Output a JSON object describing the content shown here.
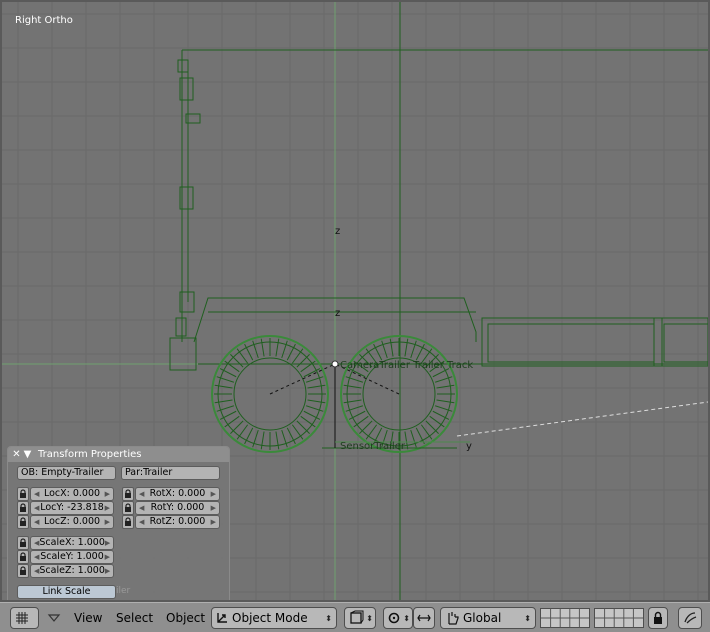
{
  "viewport": {
    "label": "Right Ortho",
    "axis_labels": {
      "z1": "z",
      "z2": "z",
      "y": "y"
    },
    "object_labels": {
      "trailer_track": "CameraTrailer  Trailer Track",
      "sensor": "SensorTrailer"
    },
    "colors": {
      "background": "#737373",
      "grid": "#6a6a6a",
      "wire": "#1f5f1f",
      "selected": "#3a8a3a"
    }
  },
  "transform_panel": {
    "title": "Transform Properties",
    "object_name": "OB: Empty-Trailer",
    "parent": "Par:Trailer",
    "loc": {
      "x": "LocX: 0.000",
      "y": "LocY: -23.818",
      "z": "LocZ: 0.000"
    },
    "rot": {
      "x": "RotX: 0.000",
      "y": "RotY: 0.000",
      "z": "RotZ: 0.000"
    },
    "scale": {
      "x": "ScaleX: 1.000",
      "y": "ScaleY: 1.000",
      "z": "ScaleZ: 1.000"
    },
    "link_scale": "Link Scale",
    "ghost_text": "iler"
  },
  "header": {
    "view_menu": "View",
    "select_menu": "Select",
    "object_menu": "Object",
    "mode": "Object Mode",
    "orientation": "Global"
  },
  "icons": [
    "grid-icon",
    "dropdown-triangle-icon",
    "mode-icon",
    "pivot-icon",
    "snap-icon",
    "manipulator-icon",
    "hand-icon",
    "lock-icon",
    "render-icon"
  ]
}
